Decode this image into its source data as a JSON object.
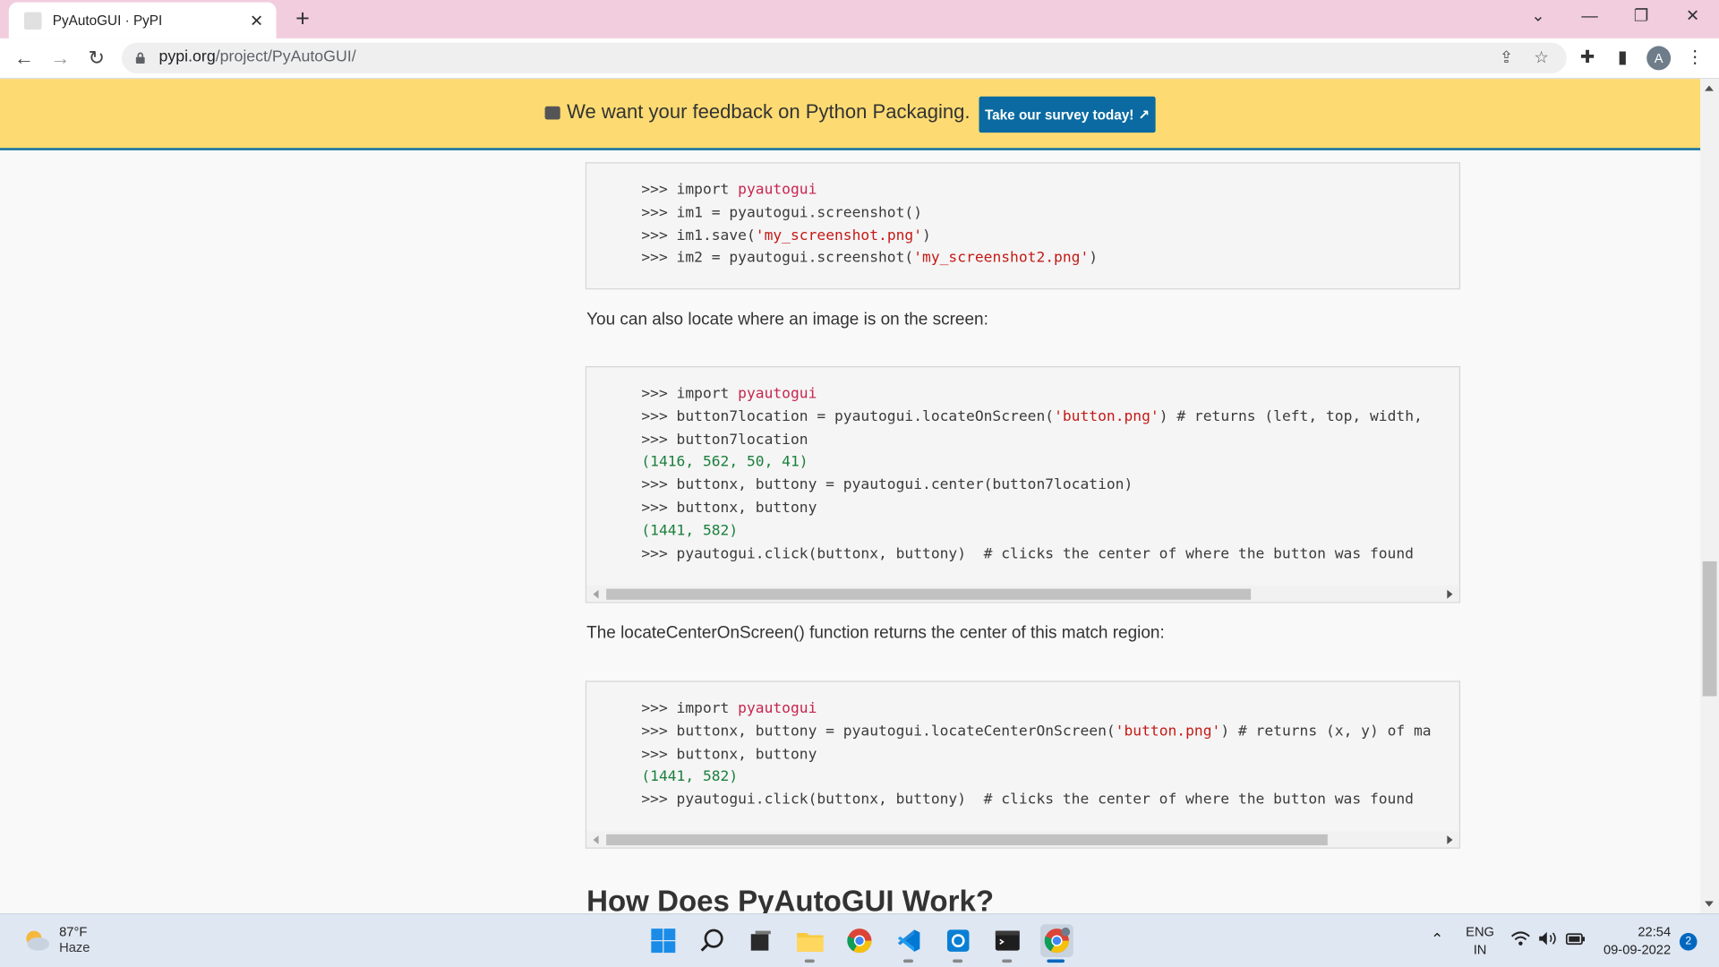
{
  "browser": {
    "tab_title": "PyPI",
    "tab_title_full": "PyAutoGUI · PyPI",
    "url_host": "pypi.org",
    "url_path": "/project/PyAutoGUI/",
    "avatar_letter": "A"
  },
  "banner": {
    "message": "We want your feedback on Python Packaging.",
    "button_label": "Take our survey today!"
  },
  "content": {
    "para1": "You can also locate where an image is on the screen:",
    "para2": "The locateCenterOnScreen() function returns the center of this match region:",
    "heading": "How Does PyAutoGUI Work?"
  },
  "code_blocks": [
    {
      "lines": [
        ">>> import pyautogui",
        ">>> im1 = pyautogui.screenshot()",
        ">>> im1.save('my_screenshot.png')",
        ">>> im2 = pyautogui.screenshot('my_screenshot2.png')"
      ]
    },
    {
      "lines": [
        ">>> import pyautogui",
        ">>> button7location = pyautogui.locateOnScreen('button.png') # returns (left, top, width,",
        ">>> button7location",
        "(1416, 562, 50, 41)",
        ">>> buttonx, buttony = pyautogui.center(button7location)",
        ">>> buttonx, buttony",
        "(1441, 582)",
        ">>> pyautogui.click(buttonx, buttony)  # clicks the center of where the button was found"
      ]
    },
    {
      "lines": [
        ">>> import pyautogui",
        ">>> buttonx, buttony = pyautogui.locateCenterOnScreen('button.png') # returns (x, y) of ma",
        ">>> buttonx, buttony",
        "(1441, 582)",
        ">>> pyautogui.click(buttonx, buttony)  # clicks the center of where the button was found"
      ]
    }
  ],
  "taskbar": {
    "weather_temp": "87°F",
    "weather_desc": "Haze",
    "lang_top": "ENG",
    "lang_bottom": "IN",
    "time": "22:54",
    "date": "09-09-2022",
    "notification_count": "2"
  },
  "colors": {
    "banner_bg": "#fddb72",
    "survey_button": "#0a6aa1",
    "tabstrip": "#f1cdde"
  }
}
